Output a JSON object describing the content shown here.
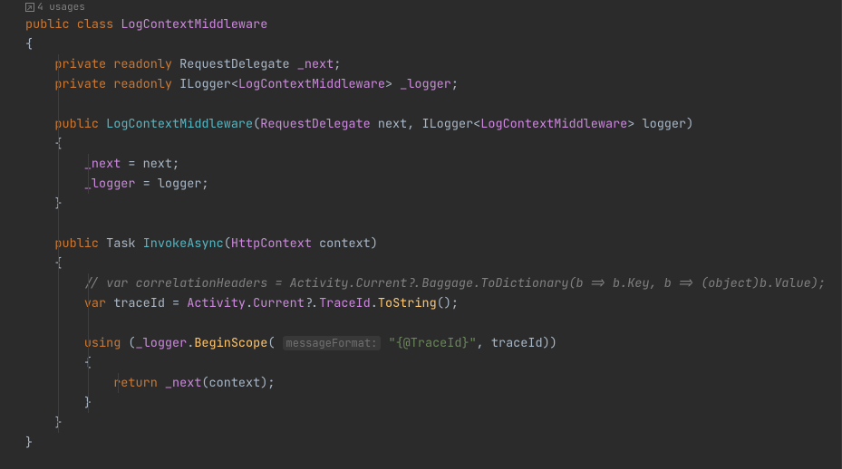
{
  "meta": {
    "usages_label": "4 usages"
  },
  "code": {
    "l1_public": "public",
    "l1_class": "class",
    "l1_name": "LogContextMiddleware",
    "l2_brace": "{",
    "l3_private": "private",
    "l3_readonly": "readonly",
    "l3_type": "RequestDelegate",
    "l3_field": "_next",
    "l3_semi": ";",
    "l4_private": "private",
    "l4_readonly": "readonly",
    "l4_ilogger": "ILogger",
    "l4_lt": "<",
    "l4_gentype": "LogContextMiddleware",
    "l4_gt": ">",
    "l4_field": "_logger",
    "l4_semi": ";",
    "l6_public": "public",
    "l6_ctor": "LogContextMiddleware",
    "l6_p1type": "RequestDelegate",
    "l6_p1name": "next",
    "l6_comma": ",",
    "l6_ilogger": "ILogger",
    "l6_lt": "<",
    "l6_gentype": "LogContextMiddleware",
    "l6_gt": ">",
    "l6_p2name": "logger",
    "l7_brace": "{",
    "l8_field": "_next",
    "l8_eq": " = next;",
    "l9_field": "_logger",
    "l9_eq": " = logger;",
    "l10_brace": "}",
    "l12_public": "public",
    "l12_task": "Task",
    "l12_method": "InvokeAsync",
    "l12_ptype": "HttpContext",
    "l12_pname": "context",
    "l13_brace": "{",
    "l14_comment": "// var correlationHeaders = Activity.Current?.Baggage.ToDictionary(b => b.Key, b => (object)b.Value);",
    "l15_var": "var",
    "l15_name": "traceId = ",
    "l15_activity": "Activity",
    "l15_dot1": ".",
    "l15_current": "Current",
    "l15_qdot": "?.",
    "l15_traceid": "TraceId",
    "l15_dot2": ".",
    "l15_tostring": "ToString",
    "l15_paren": "();",
    "l17_using": "using",
    "l17_open": " (",
    "l17_logger": "_logger",
    "l17_dot": ".",
    "l17_begin": "BeginScope",
    "l17_open2": "(",
    "l17_hint": "messageFormat:",
    "l17_str": "\"{@TraceId}\"",
    "l17_comma": ", traceId))",
    "l18_brace": "{",
    "l19_return": "return",
    "l19_next": "_next",
    "l19_call": "(context);",
    "l20_brace": "}",
    "l21_brace": "}",
    "l22_brace": "}"
  }
}
